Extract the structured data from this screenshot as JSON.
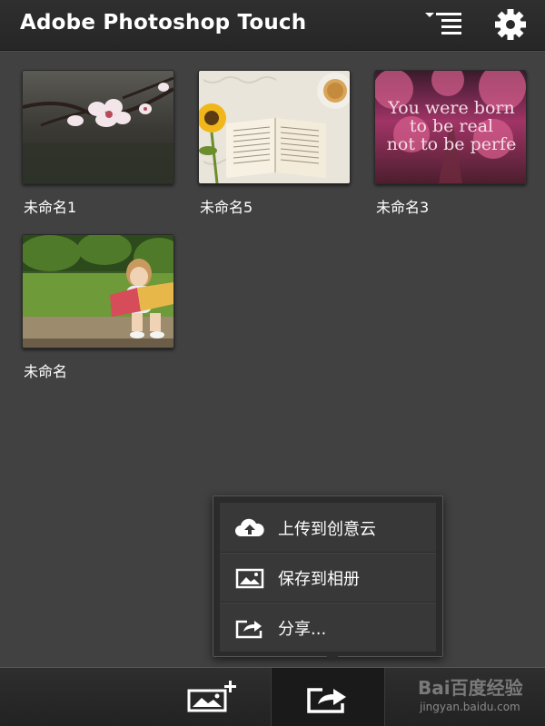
{
  "header": {
    "title": "Adobe Photoshop Touch",
    "menu_icon": "list-sort-icon",
    "settings_icon": "gear-icon"
  },
  "documents": [
    {
      "name": "未命名1",
      "thumbnail": "plum-blossom-photo"
    },
    {
      "name": "未命名5",
      "thumbnail": "book-sunflower-tea-photo"
    },
    {
      "name": "未命名3",
      "thumbnail": "pink-autumn-road-photo",
      "overlay_text": [
        "You were born",
        "to be real",
        "not to be perfe"
      ]
    },
    {
      "name": "未命名",
      "thumbnail": "girl-reading-photo"
    }
  ],
  "share_menu": {
    "items": [
      {
        "label": "上传到创意云",
        "icon": "cloud-upload-icon"
      },
      {
        "label": "保存到相册",
        "icon": "image-icon"
      },
      {
        "label": "分享...",
        "icon": "share-icon"
      }
    ]
  },
  "bottom_bar": {
    "new_icon": "add-image-icon",
    "share_icon": "share-icon"
  },
  "watermark": {
    "brand": "Bai百度经验",
    "url": "jingyan.baidu.com"
  },
  "colors": {
    "background": "#414141",
    "header": "#2a2a2a",
    "text": "#ffffff"
  }
}
